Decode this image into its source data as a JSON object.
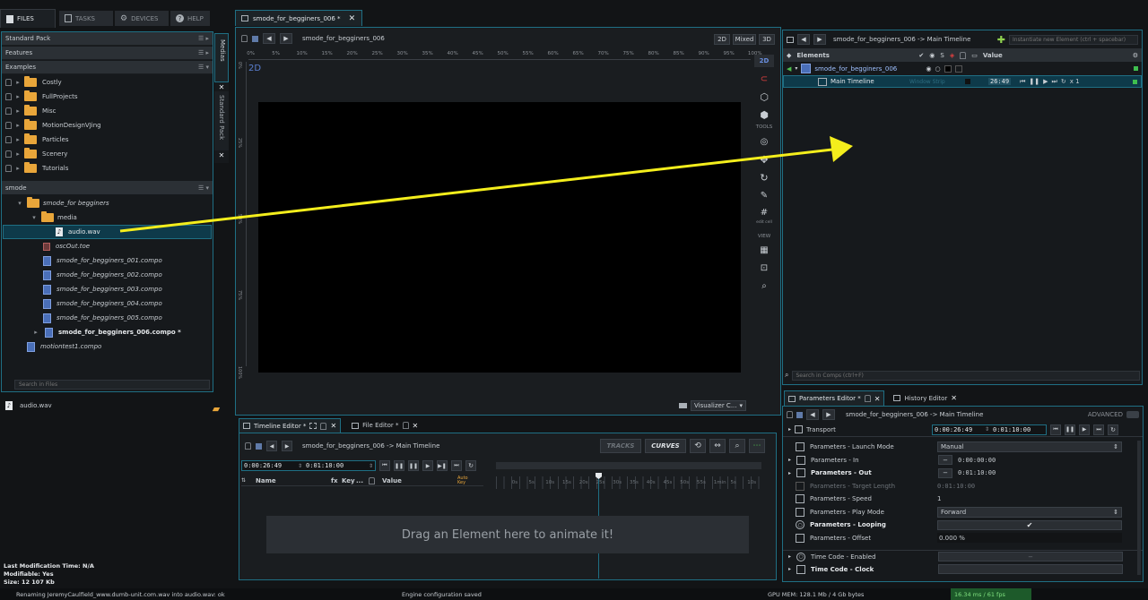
{
  "top_tabs": [
    {
      "label": "FILES"
    },
    {
      "label": "TASKS"
    },
    {
      "label": "DEVICES"
    },
    {
      "label": "HELP"
    }
  ],
  "packs": [
    "Standard Pack",
    "Features",
    "Examples"
  ],
  "examples": [
    "Costly",
    "FullProjects",
    "Misc",
    "MotionDesignVJing",
    "Particles",
    "Scenery",
    "Tutorials"
  ],
  "smode_header": "smode",
  "project": {
    "folder": "smode_for begginers",
    "media": "media",
    "audio": "audio.wav",
    "osc": "oscOut.toe",
    "compos": [
      "smode_for_begginers_001.compo",
      "smode_for_begginers_002.compo",
      "smode_for_begginers_003.compo",
      "smode_for_begginers_004.compo",
      "smode_for_begginers_005.compo"
    ],
    "current": "smode_for_begginers_006.compo *",
    "motion": "motiontest1.compo"
  },
  "search_files_placeholder": "Search in Files",
  "preview_name": "audio.wav",
  "file_info": {
    "last_mod": "Last Modification Time: N/A",
    "modifiable": "Modifiable: Yes",
    "size": "Size: 12 107 Kb"
  },
  "side_tabs": {
    "medias": "Medias",
    "standard_pack": "Standard Pack"
  },
  "viewport": {
    "tab": "smode_for_begginers_006 *",
    "path": "smode_for_begginers_006",
    "btn_2d": "2D",
    "btn_mixed": "Mixed",
    "btn_3d": "3D",
    "label_2d": "2D",
    "ruler": [
      "0%",
      "5%",
      "10%",
      "15%",
      "20%",
      "25%",
      "30%",
      "35%",
      "40%",
      "45%",
      "50%",
      "55%",
      "60%",
      "65%",
      "70%",
      "75%",
      "80%",
      "85%",
      "90%",
      "95%",
      "100%"
    ],
    "vruler": [
      "0%",
      "25%",
      "50%",
      "75%",
      "100%"
    ],
    "tools_2d": "2D",
    "tools_label": "TOOLS",
    "view_label": "VIEW",
    "edit_cell": "edit cell",
    "visualizer": "Visualizer C..."
  },
  "timeline": {
    "tab1": "Timeline Editor *",
    "tab2": "File Editor *",
    "path": "smode_for_begginers_006 -> Main Timeline",
    "tracks": "TRACKS",
    "curves": "CURVES",
    "time": "0:00:26:49",
    "duration": "0:01:10:00",
    "col_name": "Name",
    "col_fx": "fx",
    "col_key": "Key",
    "col_dots": "...",
    "col_value": "Value",
    "col_auto": "Auto Key",
    "ticks": [
      "0s",
      "5s",
      "10s",
      "15s",
      "20s",
      "25s",
      "30s",
      "35s",
      "40s",
      "45s",
      "50s",
      "55s",
      "1min",
      "5s",
      "10s"
    ],
    "drop": "Drag an Element here to animate it!"
  },
  "elements": {
    "path": "smode_for_begginers_006 -> Main Timeline",
    "instantiate_placeholder": "Instantiate new Element (ctrl + spacebar)",
    "header": "Elements",
    "value_header": "Value",
    "root": "smode_for_begginers_006",
    "child": "Main Timeline",
    "ghost": "Window Strip",
    "time": "26:49",
    "speed": "x 1",
    "search_placeholder": "Search in Comps (ctrl+F)"
  },
  "params": {
    "tab1": "Parameters Editor *",
    "tab2": "History Editor",
    "path": "smode_for_begginers_006 -> Main Timeline",
    "advanced": "ADVANCED",
    "transport": "Transport",
    "time": "0:00:26:49",
    "duration": "0:01:10:00",
    "rows": [
      {
        "label": "Parameters - Launch Mode",
        "value": "Manual"
      },
      {
        "label": "Parameters - In",
        "value": "0:00:00:00"
      },
      {
        "label": "Parameters - Out",
        "value": "0:01:10:00"
      },
      {
        "label": "Parameters - Target Length",
        "value": "0:01:10:00"
      },
      {
        "label": "Parameters - Speed",
        "value": "1"
      },
      {
        "label": "Parameters - Play Mode",
        "value": "Forward"
      },
      {
        "label": "Parameters - Looping",
        "value": ""
      },
      {
        "label": "Parameters - Offset",
        "value": "0.000 %"
      },
      {
        "label": "Time Code - Enabled",
        "value": ""
      },
      {
        "label": "Time Code - Clock",
        "value": ""
      }
    ]
  },
  "status": {
    "log": "Renaming JeremyCaulfield_www.dumb-unit.com.wav into audio.wav: ok",
    "engine": "Engine configuration saved",
    "gpu": "GPU MEM: 128.1 Mb / 4 Gb bytes",
    "fps": "16.34 ms / 61 fps"
  },
  "colors": {
    "accent_teal": "#1f6f84",
    "annotation_arrow": "#f4ee1c",
    "selection": "#0e3a4a",
    "status_green": "#1d5a2a"
  }
}
